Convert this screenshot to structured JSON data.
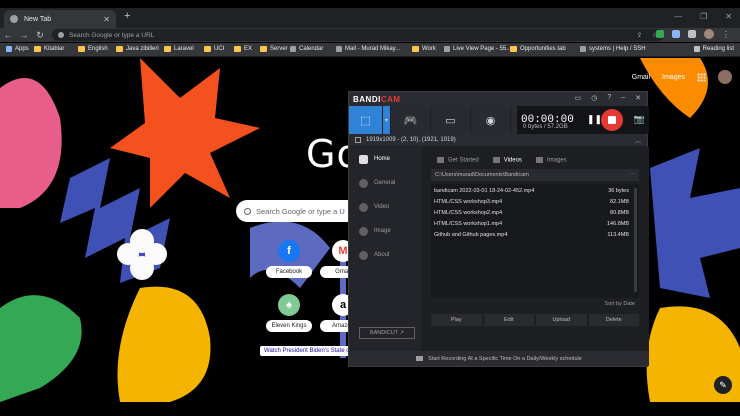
{
  "browser": {
    "tab_title": "New Tab",
    "omnibox_placeholder": "Search Google or type a URL",
    "bookmarks": [
      {
        "label": "Apps",
        "kind": "apps"
      },
      {
        "label": "Kitablar",
        "kind": "folder"
      },
      {
        "label": "English",
        "kind": "folder"
      },
      {
        "label": "Java zibilleri",
        "kind": "folder"
      },
      {
        "label": "Laravel",
        "kind": "folder"
      },
      {
        "label": "UCI",
        "kind": "folder"
      },
      {
        "label": "EX",
        "kind": "folder"
      },
      {
        "label": "Server",
        "kind": "folder"
      },
      {
        "label": "Calendar",
        "kind": "site"
      },
      {
        "label": "Mail - Murad Mikay...",
        "kind": "site"
      },
      {
        "label": "Work",
        "kind": "folder"
      },
      {
        "label": "Live View Page - 55...",
        "kind": "site"
      },
      {
        "label": "Opportunities tab",
        "kind": "folder"
      },
      {
        "label": "systems | Help / SSH",
        "kind": "site"
      }
    ],
    "reading_list": "Reading list"
  },
  "ntp": {
    "gmail": "Gmail",
    "images": "Images",
    "logo": "Go",
    "search_placeholder": "Search Google or type a U",
    "tiles": [
      {
        "label": "Facebook",
        "glyph": "f",
        "color": "#1877f2",
        "fg": "#ffffff"
      },
      {
        "label": "Gmail",
        "glyph": "M",
        "color": "#ffffff",
        "fg": "#ea4335"
      },
      {
        "label": "Eleven Kings",
        "glyph": "♠",
        "color": "#81c995",
        "fg": "#ffffff"
      },
      {
        "label": "Amazon",
        "glyph": "a",
        "color": "#ffffff",
        "fg": "#000000"
      }
    ],
    "attribution": "Watch President Biden's State of"
  },
  "bandicam": {
    "logo_bandi": "BANDI",
    "logo_cam": "CAM",
    "timer": "00:00:00",
    "size": "0 bytes / 57.2GB",
    "target": "1919x1009 - (2, 10), (1921, 1019)",
    "sidebar": [
      "Home",
      "General",
      "Video",
      "Image",
      "About"
    ],
    "badge": "BANDICUT ↗",
    "tabs": [
      "Get Started",
      "Videos",
      "Images"
    ],
    "path": "C:\\Users\\murad\\Documents\\Bandicam",
    "files": [
      {
        "name": "bandicam 2022-03-01 18-24-02-452.mp4",
        "size": "36 bytes"
      },
      {
        "name": "HTML/CSS workshop3.mp4",
        "size": "82.1MB"
      },
      {
        "name": "HTML/CSS workshop2.mp4",
        "size": "80.8MB"
      },
      {
        "name": "HTML/CSS workshop1.mp4",
        "size": "146.8MB"
      },
      {
        "name": "Github and Github pages.mp4",
        "size": "113.4MB"
      }
    ],
    "sort": "Sort by Date",
    "actions": [
      "Play",
      "Edit",
      "Upload",
      "Delete"
    ],
    "status": "Start Recording At a Specific Time On a Daily/Weekly schedule"
  }
}
